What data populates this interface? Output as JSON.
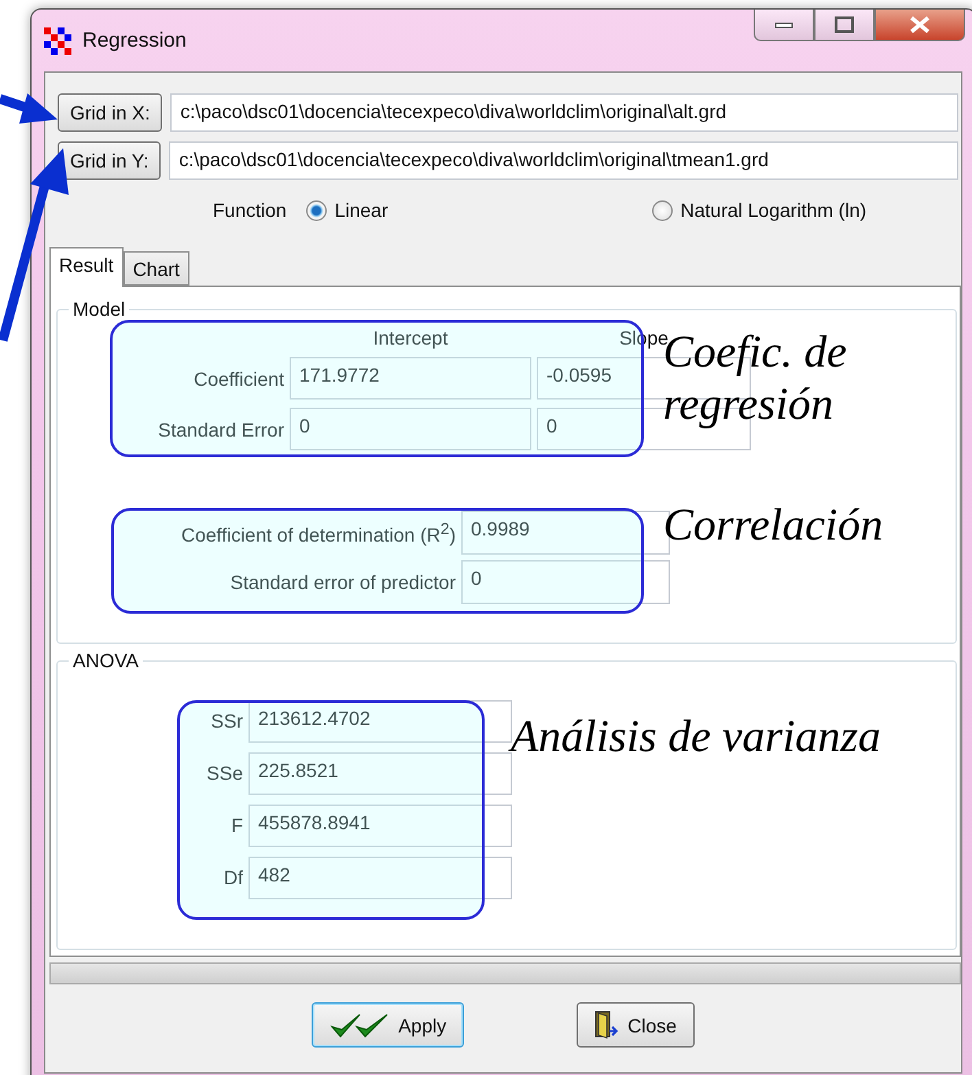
{
  "window": {
    "title": "Regression"
  },
  "inputs": [
    {
      "button": "Grid in X:",
      "path": "c:\\paco\\dsc01\\docencia\\tecexpeco\\diva\\worldclim\\original\\alt.grd"
    },
    {
      "button": "Grid in Y:",
      "path": "c:\\paco\\dsc01\\docencia\\tecexpeco\\diva\\worldclim\\original\\tmean1.grd"
    }
  ],
  "function": {
    "label": "Function",
    "options": [
      {
        "label": "Linear",
        "selected": true
      },
      {
        "label": "Natural Logarithm (ln)",
        "selected": false
      }
    ]
  },
  "tabs": [
    {
      "label": "Result",
      "selected": true
    },
    {
      "label": "Chart",
      "selected": false
    }
  ],
  "model": {
    "title": "Model",
    "columns": [
      "Intercept",
      "Slope"
    ],
    "rows": [
      {
        "label": "Coefficient",
        "values": [
          "171.9772",
          "-0.0595"
        ]
      },
      {
        "label": "Standard Error",
        "values": [
          "0",
          "0"
        ]
      }
    ],
    "fit": [
      {
        "label": "Coefficient of determination (R$^{2}$)",
        "value": "0.9989"
      },
      {
        "label": "Standard error of predictor",
        "value": "0"
      }
    ]
  },
  "anova": {
    "title": "ANOVA",
    "rows": [
      {
        "label": "SSr",
        "value": "213612.4702"
      },
      {
        "label": "SSe",
        "value": "225.8521"
      },
      {
        "label": "F",
        "value": "455878.8941"
      },
      {
        "label": "Df",
        "value": "482"
      }
    ]
  },
  "buttons": [
    {
      "label": "Apply",
      "kind": "apply"
    },
    {
      "label": "Close",
      "kind": "close"
    }
  ],
  "annotations": [
    {
      "text": "Coefic. de regresión"
    },
    {
      "text": "Correlación"
    },
    {
      "text": "Análisis de varianza"
    }
  ]
}
